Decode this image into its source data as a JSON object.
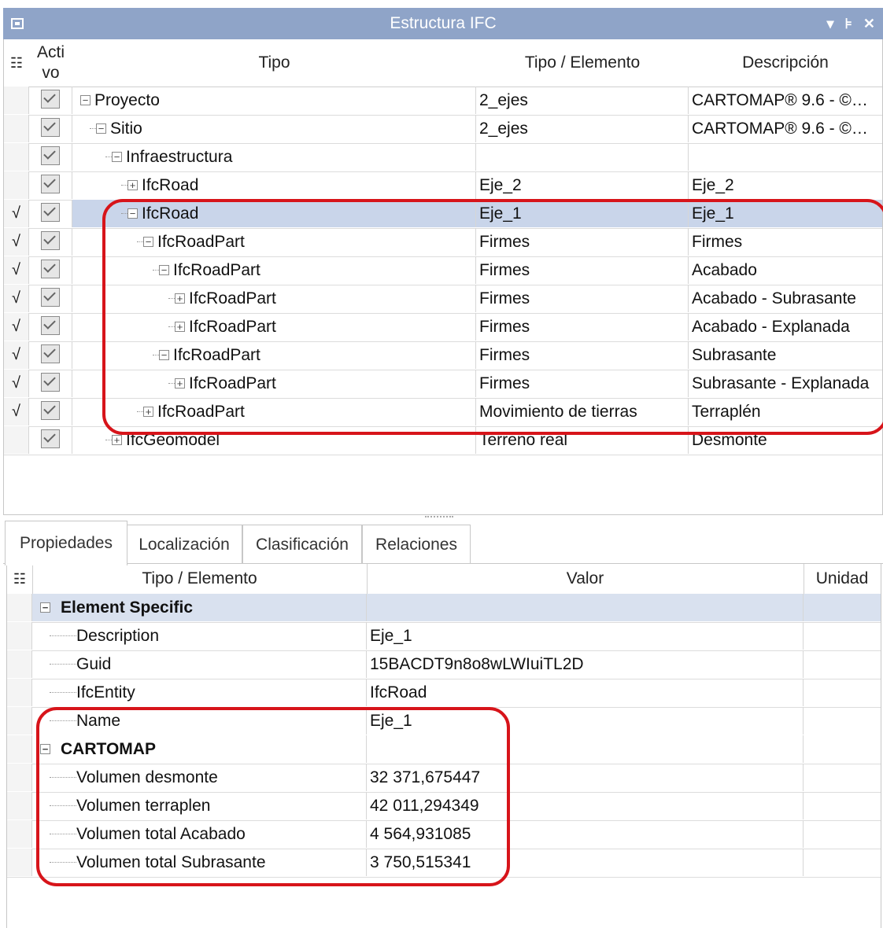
{
  "window": {
    "title": "Estructura IFC"
  },
  "tree": {
    "headers": {
      "activo": "Acti vo",
      "tipo": "Tipo",
      "tipo_elemento": "Tipo / Elemento",
      "descripcion": "Descripción"
    },
    "rows": [
      {
        "sel": "",
        "label": "Proyecto",
        "expander": "−",
        "tipo_elemento": "2_ejes",
        "descripcion": "CARTOMAP® 9.6 - ©…"
      },
      {
        "sel": "",
        "label": "Sitio",
        "expander": "−",
        "tipo_elemento": "2_ejes",
        "descripcion": "CARTOMAP® 9.6 - ©…"
      },
      {
        "sel": "",
        "label": "Infraestructura",
        "expander": "−",
        "tipo_elemento": "",
        "descripcion": ""
      },
      {
        "sel": "",
        "label": "IfcRoad",
        "expander": "+",
        "tipo_elemento": "Eje_2",
        "descripcion": "Eje_2"
      },
      {
        "sel": "√",
        "label": "IfcRoad",
        "expander": "−",
        "tipo_elemento": "Eje_1",
        "descripcion": "Eje_1"
      },
      {
        "sel": "√",
        "label": "IfcRoadPart",
        "expander": "−",
        "tipo_elemento": "Firmes",
        "descripcion": "Firmes"
      },
      {
        "sel": "√",
        "label": "IfcRoadPart",
        "expander": "−",
        "tipo_elemento": "Firmes",
        "descripcion": "Acabado"
      },
      {
        "sel": "√",
        "label": "IfcRoadPart",
        "expander": "+",
        "tipo_elemento": "Firmes",
        "descripcion": "Acabado - Subrasante"
      },
      {
        "sel": "√",
        "label": "IfcRoadPart",
        "expander": "+",
        "tipo_elemento": "Firmes",
        "descripcion": "Acabado - Explanada"
      },
      {
        "sel": "√",
        "label": "IfcRoadPart",
        "expander": "−",
        "tipo_elemento": "Firmes",
        "descripcion": "Subrasante"
      },
      {
        "sel": "√",
        "label": "IfcRoadPart",
        "expander": "+",
        "tipo_elemento": "Firmes",
        "descripcion": "Subrasante - Explanada"
      },
      {
        "sel": "√",
        "label": "IfcRoadPart",
        "expander": "+",
        "tipo_elemento": "Movimiento de tierras",
        "descripcion": "Terraplén"
      },
      {
        "sel": "",
        "label": "IfcGeomodel",
        "expander": "+",
        "tipo_elemento": "Terreno real",
        "descripcion": "Desmonte"
      }
    ]
  },
  "tabs": [
    "Propiedades",
    "Localización",
    "Clasificación",
    "Relaciones"
  ],
  "props": {
    "headers": {
      "tipo_elemento": "Tipo / Elemento",
      "valor": "Valor",
      "unidad": "Unidad"
    },
    "group1": "Element Specific",
    "group2": "CARTOMAP",
    "rows1": [
      {
        "name": "Description",
        "value": "Eje_1"
      },
      {
        "name": "Guid",
        "value": "15BACDT9n8o8wLWIuiTL2D"
      },
      {
        "name": "IfcEntity",
        "value": "IfcRoad"
      },
      {
        "name": "Name",
        "value": "Eje_1"
      }
    ],
    "rows2": [
      {
        "name": "Volumen desmonte",
        "value": "32 371,675447"
      },
      {
        "name": "Volumen terraplen",
        "value": "42 011,294349"
      },
      {
        "name": "Volumen total Acabado",
        "value": "4 564,931085"
      },
      {
        "name": "Volumen total Subrasante",
        "value": "3 750,515341"
      }
    ]
  },
  "colors": {
    "titlebar": "#8fa4c8",
    "selection": "#c9d5ea",
    "group_header": "#d9e1ef",
    "annotation": "#d7141a"
  }
}
